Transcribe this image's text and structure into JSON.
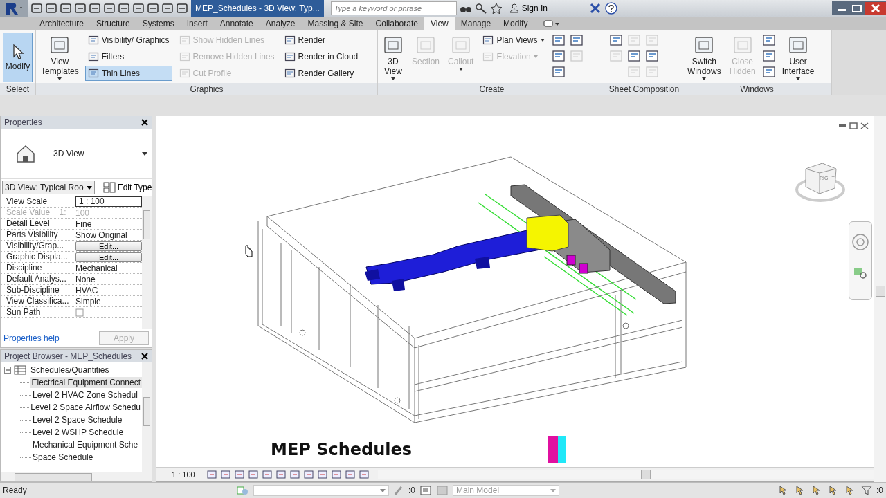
{
  "title_bar": {
    "title": "MEP_Schedules - 3D View: Typ...",
    "search": {
      "placeholder": "Type a keyword or phrase"
    },
    "sign_in": "Sign In"
  },
  "tabs": [
    {
      "label": "Architecture",
      "selected": false
    },
    {
      "label": "Structure",
      "selected": false
    },
    {
      "label": "Systems",
      "selected": false
    },
    {
      "label": "Insert",
      "selected": false
    },
    {
      "label": "Annotate",
      "selected": false
    },
    {
      "label": "Analyze",
      "selected": false
    },
    {
      "label": "Massing & Site",
      "selected": false
    },
    {
      "label": "Collaborate",
      "selected": false
    },
    {
      "label": "View",
      "selected": true
    },
    {
      "label": "Manage",
      "selected": false
    },
    {
      "label": "Modify",
      "selected": false
    }
  ],
  "ribbon": [
    {
      "label": "Select",
      "columns": [
        {
          "kind": "select",
          "label": "Modify",
          "selected": true,
          "disabled": false,
          "dropdown": false
        }
      ]
    },
    {
      "label": "Graphics",
      "columns": [
        {
          "kind": "large",
          "label": "View Templates",
          "selected": false,
          "disabled": false,
          "dropdown": true
        },
        {
          "kind": "stack",
          "items": [
            {
              "label": "Visibility/ Graphics",
              "selected": false,
              "disabled": false,
              "dropdown": false
            },
            {
              "label": "Filters",
              "selected": false,
              "disabled": false,
              "dropdown": false
            },
            {
              "label": "Thin Lines",
              "selected": true,
              "disabled": false,
              "dropdown": false
            }
          ]
        },
        {
          "kind": "stack",
          "items": [
            {
              "label": "Show Hidden Lines",
              "selected": false,
              "disabled": true,
              "dropdown": false
            },
            {
              "label": "Remove Hidden Lines",
              "selected": false,
              "disabled": true,
              "dropdown": false
            },
            {
              "label": "Cut Profile",
              "selected": false,
              "disabled": true,
              "dropdown": false
            }
          ]
        },
        {
          "kind": "stack",
          "items": [
            {
              "label": "Render",
              "selected": false,
              "disabled": false,
              "dropdown": false
            },
            {
              "label": "Render in Cloud",
              "selected": false,
              "disabled": false,
              "dropdown": false
            },
            {
              "label": "Render Gallery",
              "selected": false,
              "disabled": false,
              "dropdown": false
            }
          ]
        }
      ]
    },
    {
      "label": "Create",
      "columns": [
        {
          "kind": "large",
          "label": "3D View",
          "selected": false,
          "disabled": false,
          "dropdown": true
        },
        {
          "kind": "large",
          "label": "Section",
          "selected": false,
          "disabled": true,
          "dropdown": false
        },
        {
          "kind": "large",
          "label": "Callout",
          "selected": false,
          "disabled": true,
          "dropdown": true
        },
        {
          "kind": "stack",
          "items": [
            {
              "label": "Plan Views",
              "selected": false,
              "disabled": false,
              "dropdown": true
            },
            {
              "label": "Elevation",
              "selected": false,
              "disabled": true,
              "dropdown": true
            }
          ]
        },
        {
          "kind": "icons",
          "items": [
            {
              "disabled": false
            },
            {
              "disabled": false
            },
            {
              "disabled": false
            }
          ]
        },
        {
          "kind": "icons",
          "items": [
            {
              "disabled": false
            },
            {
              "disabled": true
            }
          ]
        }
      ]
    },
    {
      "label": "Sheet Composition",
      "columns": [
        {
          "kind": "icons",
          "items": [
            {
              "disabled": false
            },
            {
              "disabled": true
            }
          ]
        },
        {
          "kind": "icons",
          "items": [
            {
              "disabled": true
            },
            {
              "disabled": false
            },
            {
              "disabled": true
            }
          ]
        },
        {
          "kind": "icons",
          "items": [
            {
              "disabled": true
            },
            {
              "disabled": false
            },
            {
              "disabled": true
            }
          ]
        }
      ]
    },
    {
      "label": "Windows",
      "columns": [
        {
          "kind": "large",
          "label": "Switch Windows",
          "selected": false,
          "disabled": false,
          "dropdown": true
        },
        {
          "kind": "large",
          "label": "Close Hidden",
          "selected": false,
          "disabled": true,
          "dropdown": false
        },
        {
          "kind": "icons",
          "items": [
            {
              "disabled": false
            },
            {
              "disabled": false
            },
            {
              "disabled": false
            }
          ]
        },
        {
          "kind": "large",
          "label": "User Interface",
          "selected": false,
          "disabled": false,
          "dropdown": true
        }
      ]
    }
  ],
  "properties": {
    "title": "Properties",
    "type_name": "3D View",
    "type_selector": "3D View: Typical Roo",
    "edit_type": "Edit Type",
    "rows": [
      {
        "name": "View Scale",
        "value": "1 : 100",
        "kind": "input",
        "disabled": false
      },
      {
        "name": "Scale Value    1:",
        "value": "100",
        "kind": "text",
        "disabled": true
      },
      {
        "name": "Detail Level",
        "value": "Fine",
        "kind": "text",
        "disabled": false
      },
      {
        "name": "Parts Visibility",
        "value": "Show Original",
        "kind": "text",
        "disabled": false
      },
      {
        "name": "Visibility/Grap...",
        "value": "Edit...",
        "kind": "button",
        "disabled": false
      },
      {
        "name": "Graphic Displa...",
        "value": "Edit...",
        "kind": "button",
        "disabled": false
      },
      {
        "name": "Discipline",
        "value": "Mechanical",
        "kind": "text",
        "disabled": false
      },
      {
        "name": "Default Analys...",
        "value": "None",
        "kind": "text",
        "disabled": false
      },
      {
        "name": "Sub-Discipline",
        "value": "HVAC",
        "kind": "text",
        "disabled": false
      },
      {
        "name": "View Classifica...",
        "value": "Simple",
        "kind": "text",
        "disabled": false
      },
      {
        "name": "Sun Path",
        "kind": "checkbox",
        "checked": false,
        "disabled": false
      }
    ],
    "help": "Properties help",
    "apply": {
      "label": "Apply",
      "disabled": true
    }
  },
  "project_browser": {
    "title": "Project Browser - MEP_Schedules",
    "tree": [
      {
        "label": "Schedules/Quantities",
        "expanded": true,
        "selected": false,
        "children": [
          {
            "label": "Electrical Equipment Connect",
            "selected": true
          },
          {
            "label": "Level 2 HVAC Zone Schedul",
            "selected": false
          },
          {
            "label": "Level 2 Space Airflow Schedu",
            "selected": false
          },
          {
            "label": "Level 2 Space Schedule",
            "selected": false
          },
          {
            "label": "Level 2 WSHP Schedule",
            "selected": false
          },
          {
            "label": "Mechanical Equipment Sche",
            "selected": false
          },
          {
            "label": "Space Schedule",
            "selected": false
          }
        ]
      }
    ]
  },
  "view": {
    "caption": "MEP Schedules",
    "viewcube_label": "RIGHT",
    "scale": "1 : 100"
  },
  "status_bar": {
    "message": "Ready",
    "workset_count": ":0",
    "model": "Main Model",
    "filter_count": ":0"
  }
}
